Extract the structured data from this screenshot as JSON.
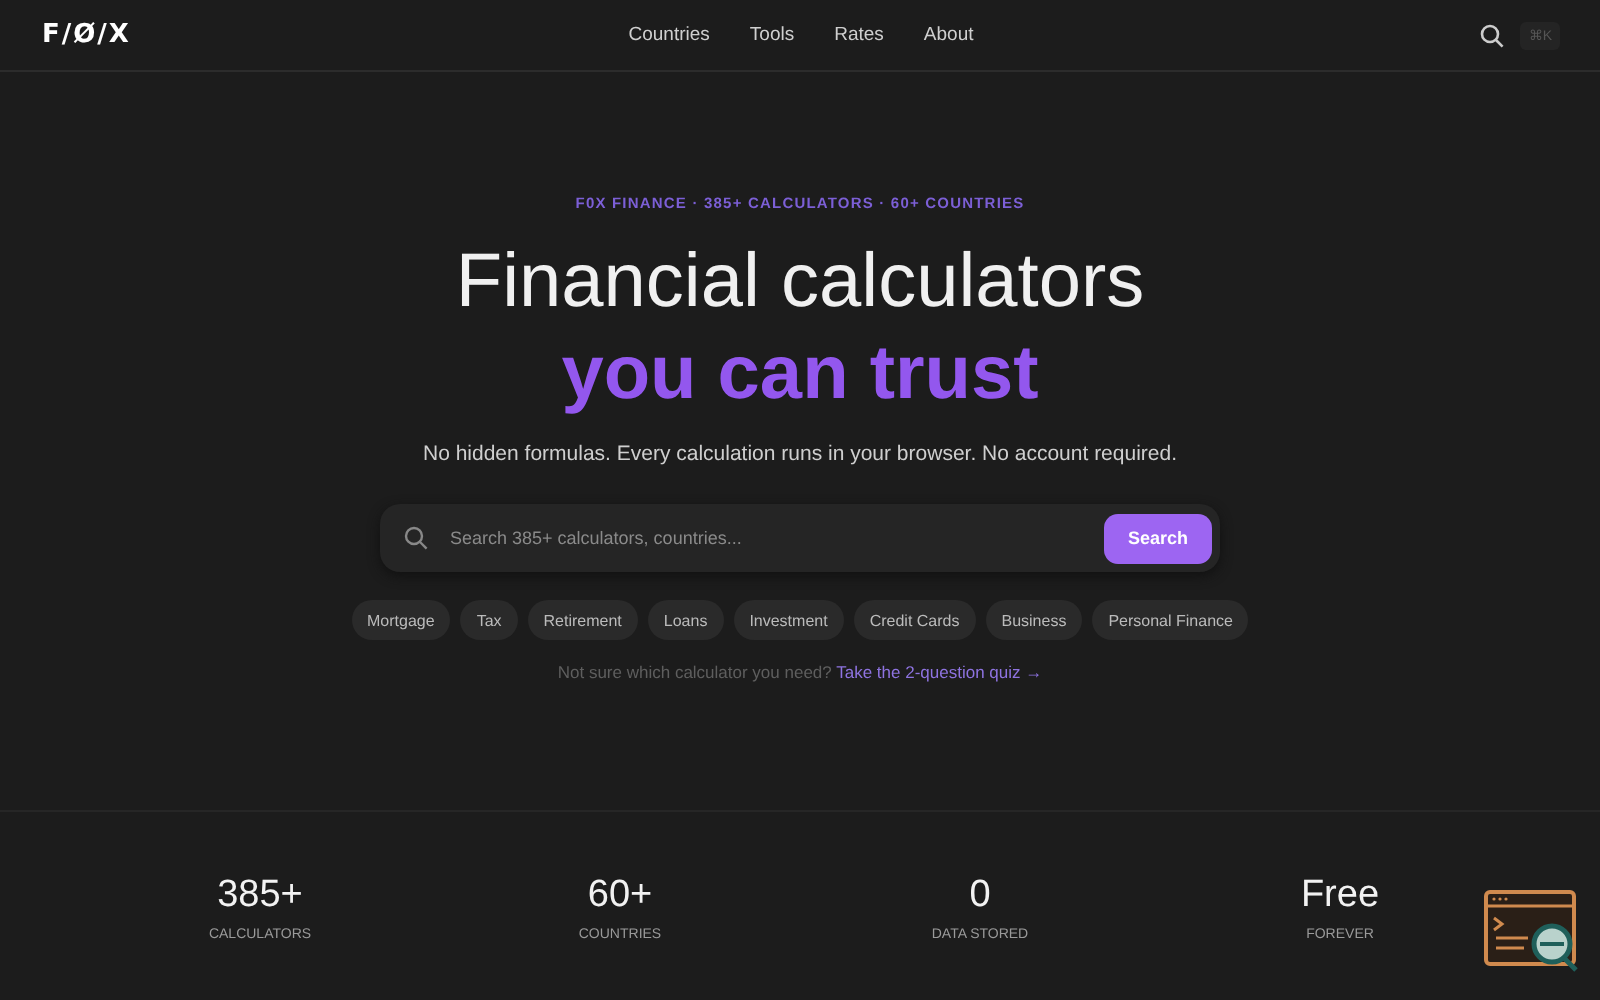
{
  "header": {
    "logo": "F/Ø/X",
    "nav": [
      {
        "label": "Countries"
      },
      {
        "label": "Tools"
      },
      {
        "label": "Rates"
      },
      {
        "label": "About"
      }
    ],
    "shortcut": "⌘K"
  },
  "hero": {
    "eyebrow": "F0X FINANCE · 385+ CALCULATORS · 60+ COUNTRIES",
    "title_line_1": "Financial calculators",
    "title_line_2": "you can trust",
    "subtitle": "No hidden formulas. Every calculation runs in your browser. No account required.",
    "search": {
      "placeholder": "Search 385+ calculators, countries...",
      "button": "Search"
    },
    "categories": [
      "Mortgage",
      "Tax",
      "Retirement",
      "Loans",
      "Investment",
      "Credit Cards",
      "Business",
      "Personal Finance"
    ],
    "quiz_prompt": "Not sure which calculator you need?",
    "quiz_link": "Take the 2-question quiz →"
  },
  "stats": [
    {
      "value": "385+",
      "label": "CALCULATORS"
    },
    {
      "value": "60+",
      "label": "COUNTRIES"
    },
    {
      "value": "0",
      "label": "DATA STORED"
    },
    {
      "value": "Free",
      "label": "FOREVER"
    }
  ]
}
